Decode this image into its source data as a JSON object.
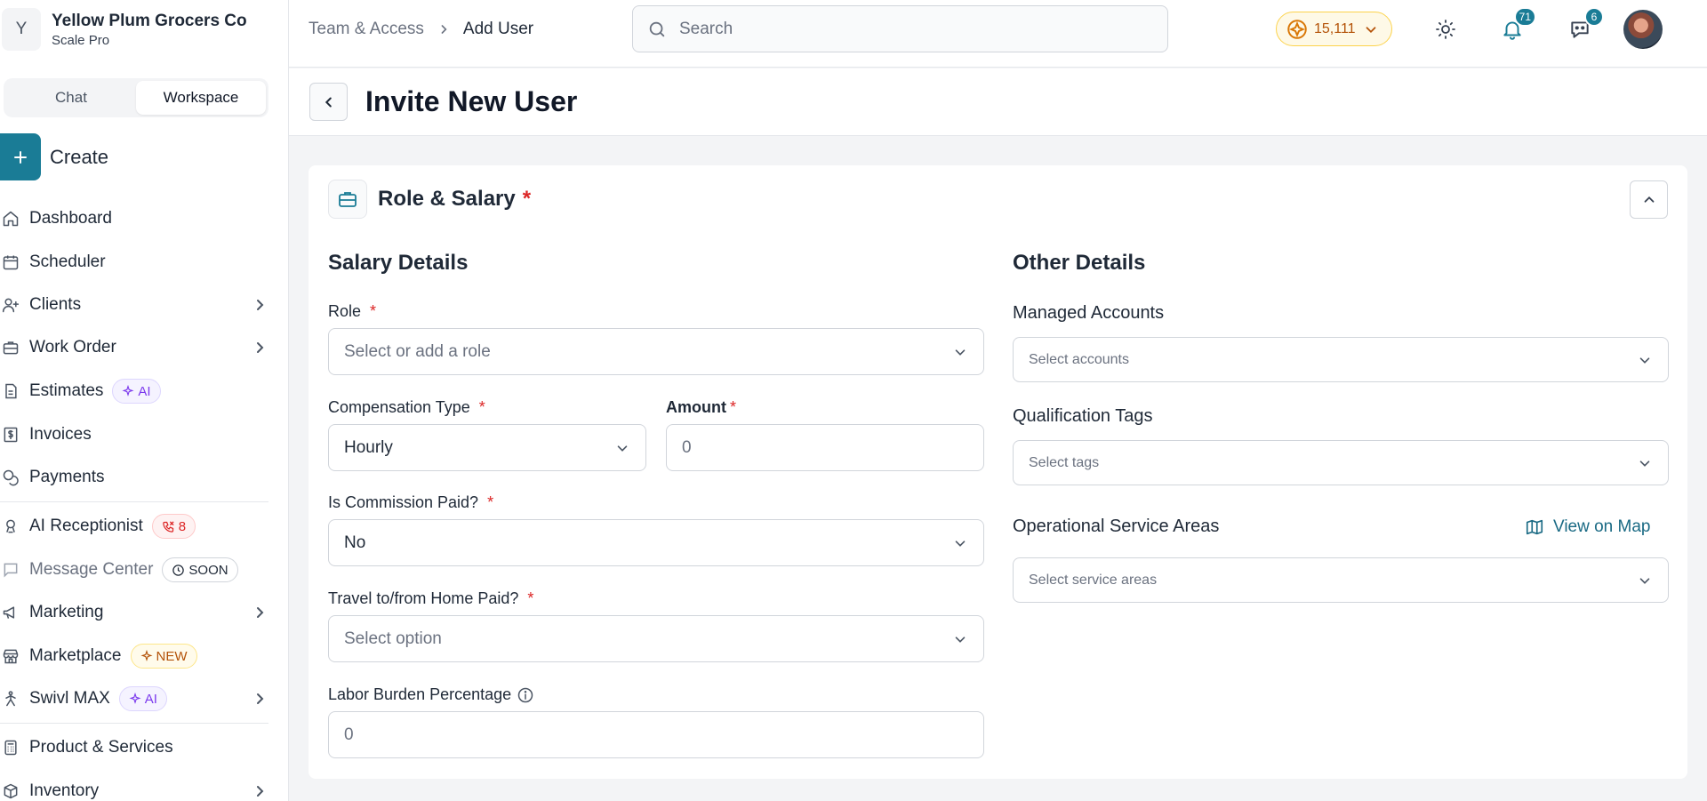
{
  "org": {
    "initial": "Y",
    "name": "Yellow Plum Grocers Co",
    "plan": "Scale Pro"
  },
  "modes": {
    "chat": "Chat",
    "workspace": "Workspace"
  },
  "create_label": "Create",
  "nav": {
    "dashboard": "Dashboard",
    "scheduler": "Scheduler",
    "clients": "Clients",
    "work_order": "Work Order",
    "estimates": "Estimates",
    "estimates_badge": "AI",
    "invoices": "Invoices",
    "payments": "Payments",
    "ai_receptionist": "AI Receptionist",
    "ai_receptionist_badge": "8",
    "message_center": "Message Center",
    "message_center_badge": "SOON",
    "marketing": "Marketing",
    "marketplace": "Marketplace",
    "marketplace_badge": "NEW",
    "swivl_max": "Swivl MAX",
    "swivl_max_badge": "AI",
    "product_services": "Product & Services",
    "inventory": "Inventory"
  },
  "breadcrumb": {
    "parent": "Team & Access",
    "current": "Add User"
  },
  "search": {
    "placeholder": "Search"
  },
  "credits": {
    "value": "15,111"
  },
  "notifications": {
    "count": "71"
  },
  "messages": {
    "count": "6"
  },
  "page": {
    "title": "Invite New User"
  },
  "section": {
    "title": "Role & Salary",
    "required_mark": "*"
  },
  "salary": {
    "title": "Salary Details",
    "role_label": "Role",
    "role_placeholder": "Select or add a role",
    "comp_type_label": "Compensation Type",
    "comp_type_value": "Hourly",
    "amount_label": "Amount",
    "amount_placeholder": "0",
    "commission_label": "Is Commission Paid?",
    "commission_value": "No",
    "travel_label": "Travel to/from Home Paid?",
    "travel_placeholder": "Select option",
    "labor_label": "Labor Burden Percentage",
    "labor_placeholder": "0"
  },
  "other": {
    "title": "Other Details",
    "accounts_label": "Managed Accounts",
    "accounts_placeholder": "Select accounts",
    "tags_label": "Qualification Tags",
    "tags_placeholder": "Select tags",
    "areas_label": "Operational Service Areas",
    "map_link": "View on Map",
    "areas_placeholder": "Select service areas"
  },
  "colors": {
    "accent": "#1a7c96",
    "required": "#dc2626",
    "credits": "#b45309"
  }
}
